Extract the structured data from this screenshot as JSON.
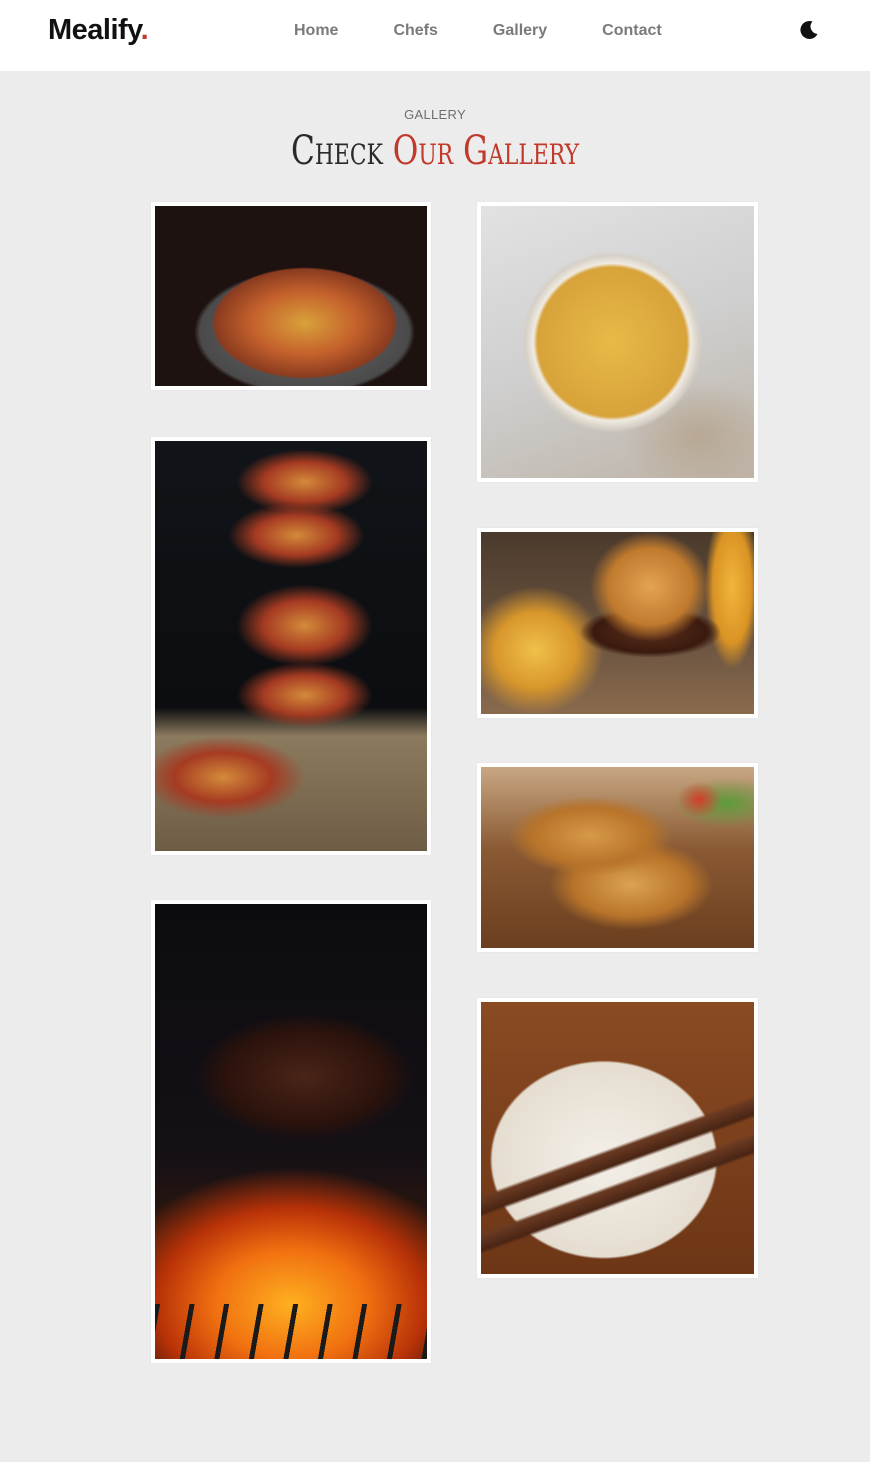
{
  "header": {
    "logo_text": "Mealify",
    "logo_dot": ".",
    "nav": [
      {
        "label": "Home"
      },
      {
        "label": "Chefs"
      },
      {
        "label": "Gallery"
      },
      {
        "label": "Contact"
      }
    ],
    "theme_toggle_icon": "moon-icon"
  },
  "gallery": {
    "label": "GALLERY",
    "title_part1": "Check",
    "title_part2": "Our Gallery"
  },
  "colors": {
    "accent": "#c0392b",
    "background": "#ececec",
    "header_bg": "#ffffff"
  }
}
